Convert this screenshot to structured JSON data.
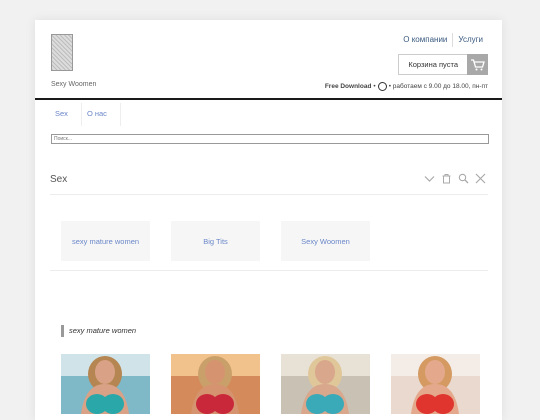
{
  "header": {
    "site_name": "Sexy Woomen",
    "links": [
      "О компании",
      "Услуги"
    ],
    "cart_label": "Корзина пуста",
    "contact_bold": "Free Download",
    "contact_text": "• работаем с 9.00 до 18.00, пн-пт"
  },
  "nav": {
    "items": [
      "Sex",
      "О нас"
    ]
  },
  "search": {
    "placeholder": "Поиск..."
  },
  "panel": {
    "title": "Sex",
    "icons": [
      "chevron-down-icon",
      "trash-icon",
      "zoom-icon",
      "close-icon"
    ]
  },
  "categories": [
    "sexy mature women",
    "Big Tits",
    "Sexy Woomen"
  ],
  "section": {
    "title": "sexy mature women"
  },
  "photos": [
    {
      "bg": "#7fb8c7",
      "top": "#cfe3e8",
      "skin": "#d9a287",
      "hair": "#b58652",
      "suit": "#2aa7a9"
    },
    {
      "bg": "#d48a5a",
      "top": "#f2c28c",
      "skin": "#d5946f",
      "hair": "#caa06a",
      "suit": "#c9283a"
    },
    {
      "bg": "#c9c2b4",
      "top": "#e8e2d6",
      "skin": "#d9a78c",
      "hair": "#e0c79a",
      "suit": "#3aa9b8"
    },
    {
      "bg": "#e9d9cf",
      "top": "#f4ece6",
      "skin": "#e4a98c",
      "hair": "#d49a62",
      "suit": "#e0352e"
    }
  ],
  "colors": {
    "accent": "#6b88c9",
    "cart_button": "#a8a8a8",
    "rule": "#1a1a1a"
  }
}
